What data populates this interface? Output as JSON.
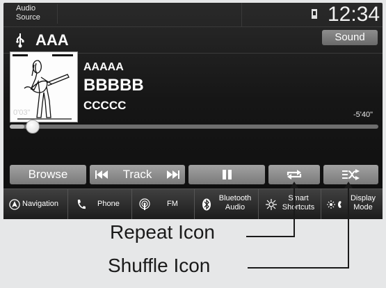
{
  "header": {
    "audio_source_label": "Audio\nSource",
    "clock": "12:34"
  },
  "source": {
    "name": "AAA",
    "sound_label": "Sound"
  },
  "now_playing": {
    "line1": "AAAAA",
    "line2": "BBBBB",
    "line3": "CCCCC",
    "elapsed": "0'03\"",
    "remaining": "-5'40\"",
    "progress": 0.04
  },
  "controls": {
    "browse_label": "Browse",
    "track_label": "Track"
  },
  "bottom_nav": [
    {
      "label": "Navigation",
      "icon": "navigation-arrow-icon"
    },
    {
      "label": "Phone",
      "icon": "phone-icon"
    },
    {
      "label": "FM",
      "icon": "radio-antenna-icon"
    },
    {
      "label": "Bluetooth\nAudio",
      "icon": "bluetooth-icon"
    },
    {
      "label": "Smart\nShortcuts",
      "icon": "smart-shortcuts-icon"
    },
    {
      "label": "Display\nMode",
      "icon": "display-mode-icon"
    }
  ],
  "annotations": {
    "repeat": "Repeat Icon",
    "shuffle": "Shuffle Icon"
  },
  "colors": {
    "screen_bg": "#141414",
    "button": "#8c8c8c",
    "page_bg": "#e6e7e8"
  }
}
